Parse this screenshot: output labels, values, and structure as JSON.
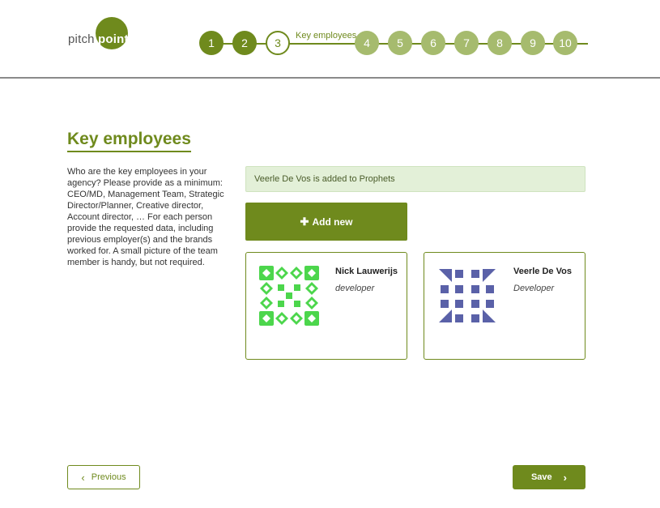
{
  "logo": {
    "part1": "pitch",
    "part2": "point"
  },
  "stepper": {
    "steps": [
      "1",
      "2",
      "3",
      "4",
      "5",
      "6",
      "7",
      "8",
      "9",
      "10"
    ],
    "current_caption": "Key employees"
  },
  "page": {
    "title": "Key employees",
    "intro": "Who are the key employees in your agency? Please provide as a minimum: CEO/MD, Management Team, Strategic Director/Planner, Creative director, Account director, … For each person provide the requested data, including previous employer(s) and the brands worked for. A small picture of the team member is handy, but not required.",
    "alert": "Veerle De Vos is added to Prophets",
    "add_new_label": "Add new"
  },
  "employees": [
    {
      "name": "Nick Lauwerijs",
      "role": "developer",
      "avatar_icon": "identicon-green"
    },
    {
      "name": "Veerle De Vos",
      "role": "Developer",
      "avatar_icon": "identicon-blue"
    }
  ],
  "footer": {
    "previous_label": "Previous",
    "save_label": "Save"
  },
  "colors": {
    "brand": "#6f8a1d",
    "step_todo": "#a6bb6e",
    "alert_bg": "#e3f0d8",
    "identicon_green": "#4cd64c",
    "identicon_blue": "#5a61a8"
  }
}
